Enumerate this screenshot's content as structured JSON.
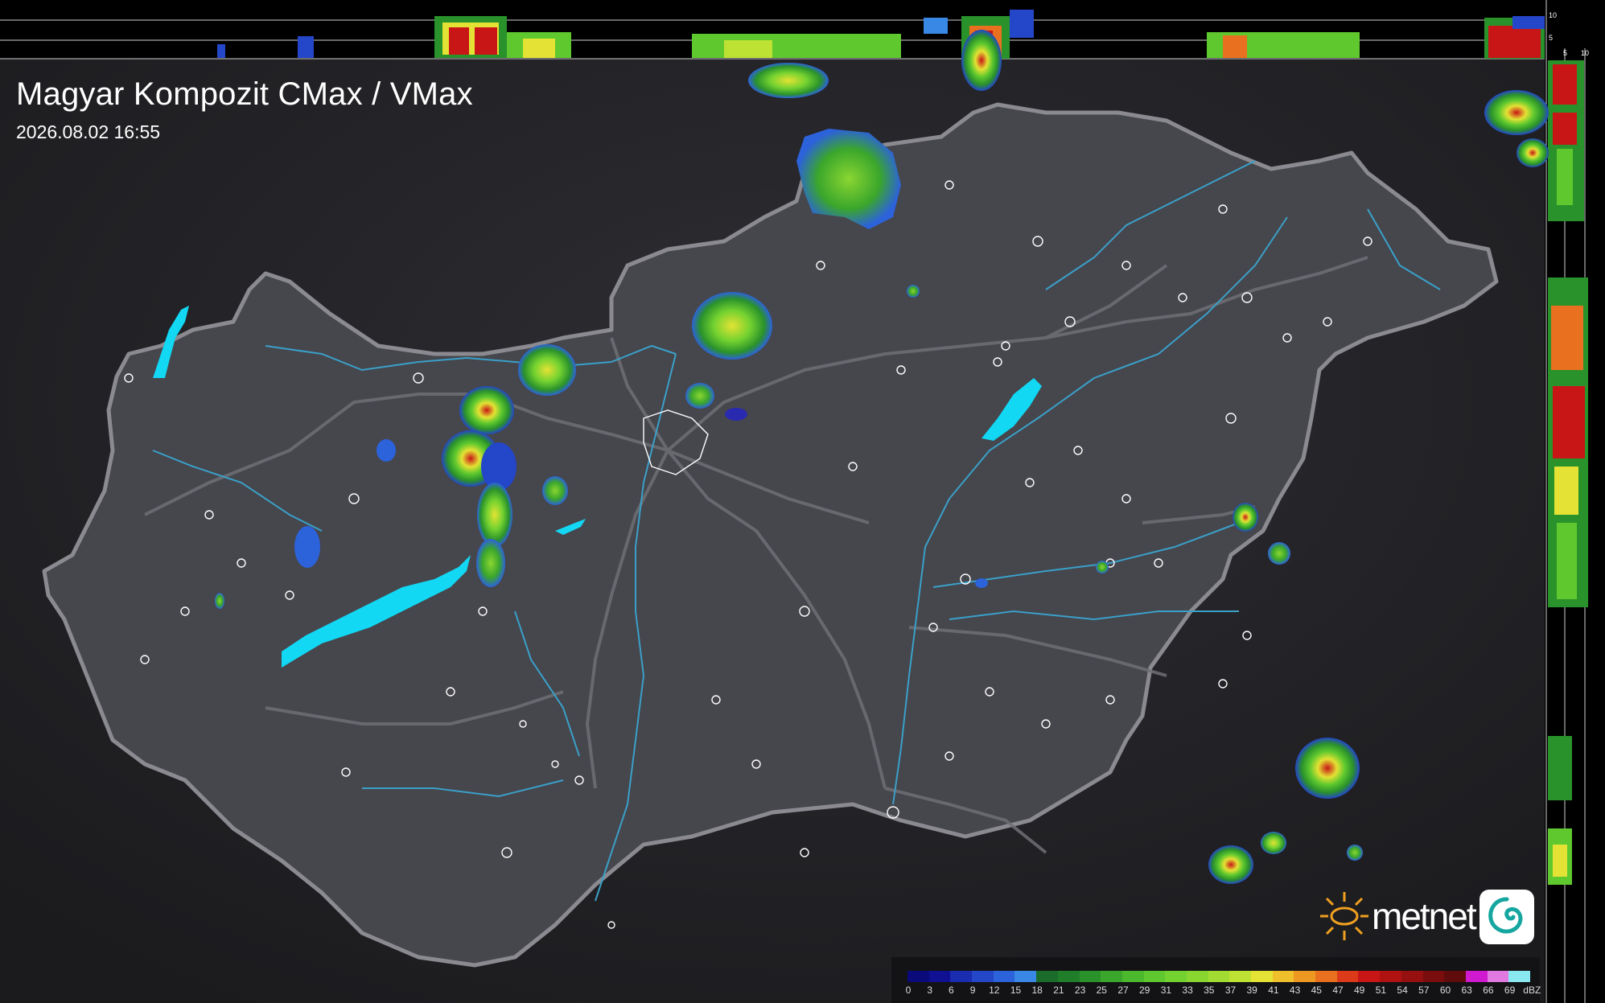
{
  "title": "Magyar Kompozit CMax / VMax",
  "timestamp": "2026.08.02 16:55",
  "brand": {
    "name": "metnet"
  },
  "profile_axes": {
    "top_ticks": [
      "10",
      "5"
    ],
    "side_ticks": [
      "5",
      "10"
    ]
  },
  "legend": {
    "unit": "dBZ",
    "labels": [
      "0",
      "3",
      "6",
      "9",
      "12",
      "15",
      "18",
      "21",
      "23",
      "25",
      "27",
      "29",
      "31",
      "33",
      "35",
      "37",
      "39",
      "41",
      "43",
      "45",
      "47",
      "49",
      "51",
      "54",
      "57",
      "60",
      "63",
      "66",
      "69"
    ],
    "colors": [
      "#0a0a7a",
      "#101092",
      "#1a2cb0",
      "#2446c8",
      "#2c62da",
      "#3a88e6",
      "#1b6b2a",
      "#207e2a",
      "#2a922b",
      "#3aa62c",
      "#4cb82d",
      "#5ec82e",
      "#74d230",
      "#8ad631",
      "#a2dc32",
      "#bde233",
      "#e4e234",
      "#f0c02c",
      "#ee9824",
      "#e8701e",
      "#dc3a18",
      "#c81616",
      "#b01212",
      "#961010",
      "#7a0e0e",
      "#600c0c",
      "#d01ad0",
      "#e07ae0",
      "#8ae8f0"
    ]
  },
  "colors": {
    "background": "#1f1f22",
    "country_fill": "#4a4a52",
    "rivers": "#3aa0c8",
    "lakes": "#12d8f4",
    "roads": "#7a7a80",
    "city_outline": "#ffffff"
  }
}
